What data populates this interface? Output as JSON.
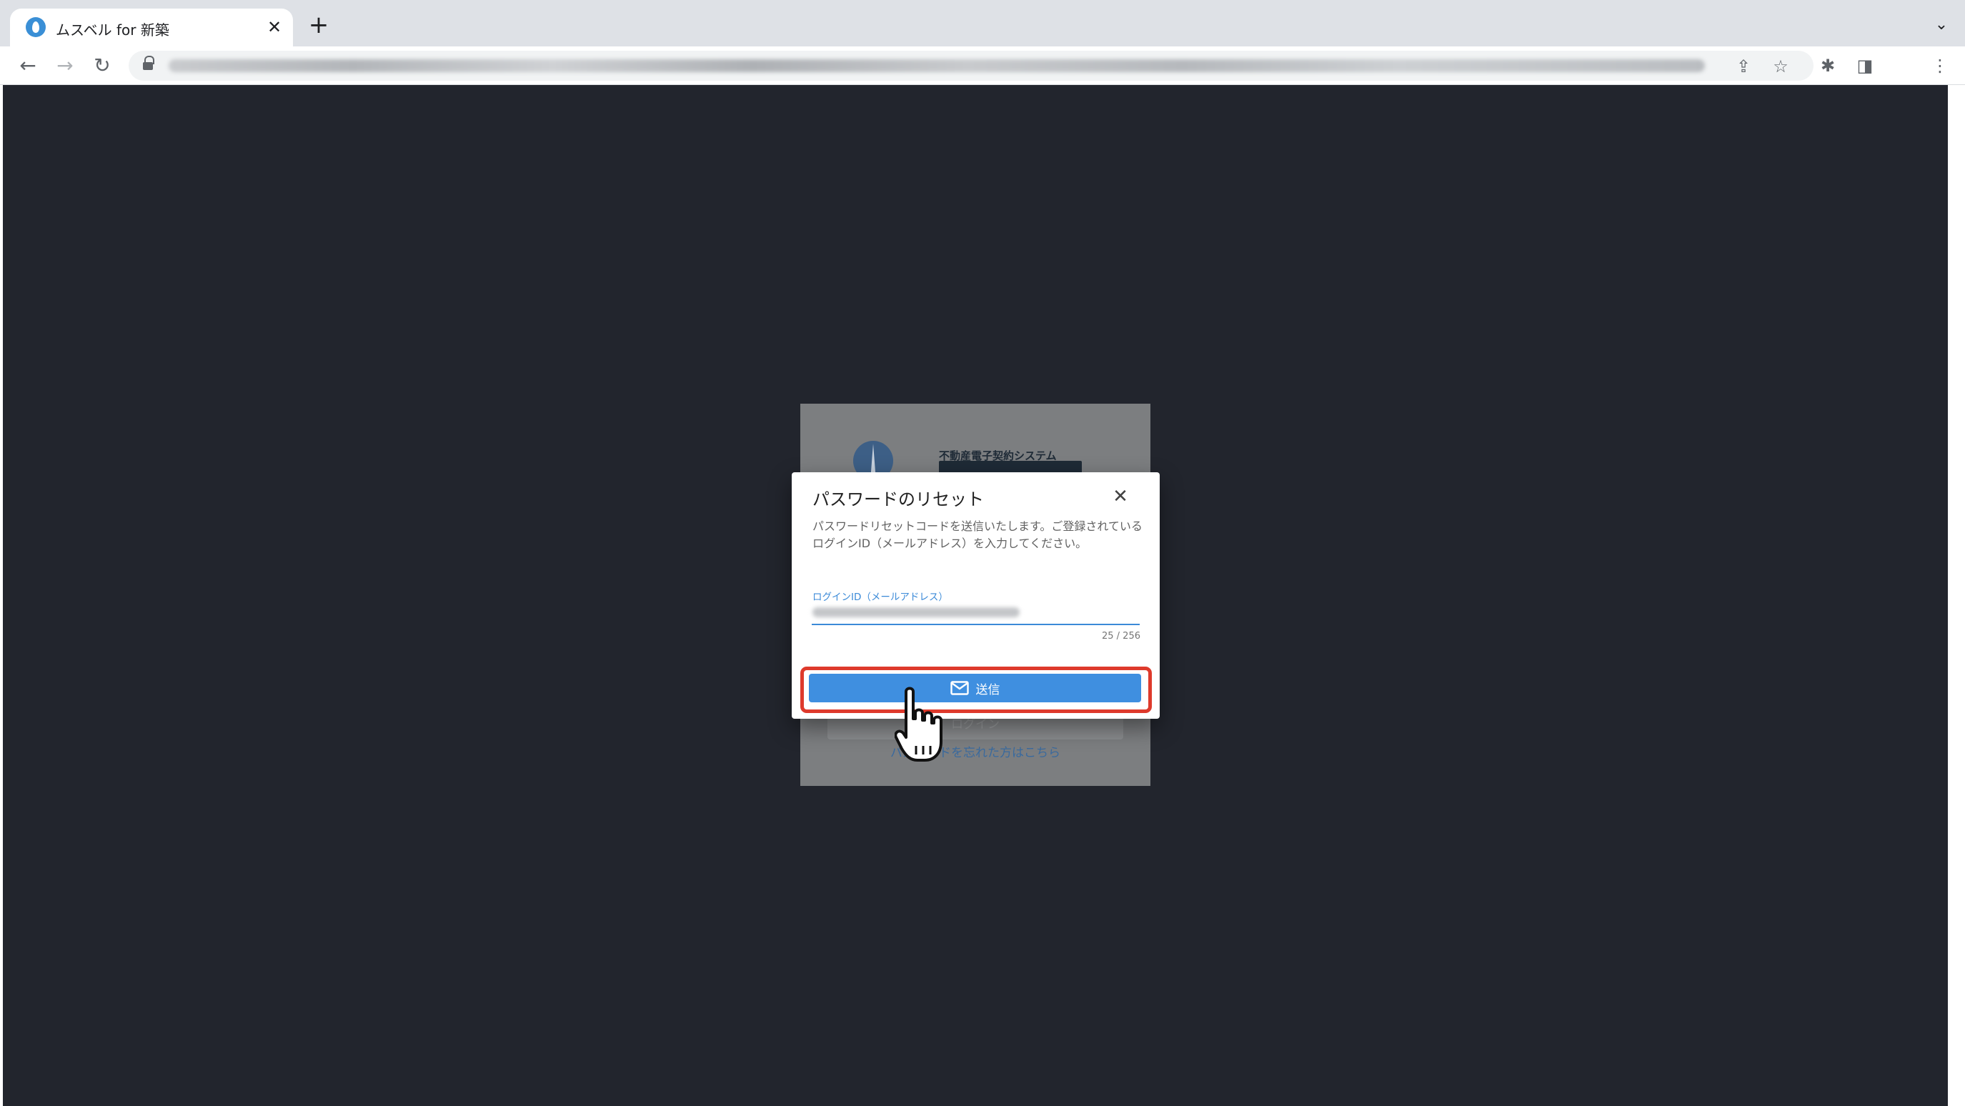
{
  "browser": {
    "tab_title": "ムスベル for 新築",
    "tab_close": "✕",
    "new_tab": "+",
    "tab_menu": "⌄",
    "nav_back": "←",
    "nav_forward": "→",
    "nav_reload": "↻",
    "omnibox_share": "⇪",
    "omnibox_star": "☆",
    "extensions": "✱",
    "sidebar": "◨",
    "menu": "⋮"
  },
  "login_card": {
    "logo_caption": "不動産電子契約システム",
    "login_button_label": "ログイン",
    "forgot_link": "パスワードを忘れた方はこちら"
  },
  "dialog": {
    "title": "パスワードのリセット",
    "close_label": "✕",
    "description": "パスワードリセットコードを送信いたします。ご登録されているログインID（メールアドレス）を入力してください。",
    "field": {
      "label": "ログインID（メールアドレス）",
      "counter": "25 / 256"
    },
    "submit_label": "送信"
  },
  "colors": {
    "overlay_background": "#22252d",
    "primary": "#3f8fe0",
    "highlight": "#de3a2c"
  }
}
